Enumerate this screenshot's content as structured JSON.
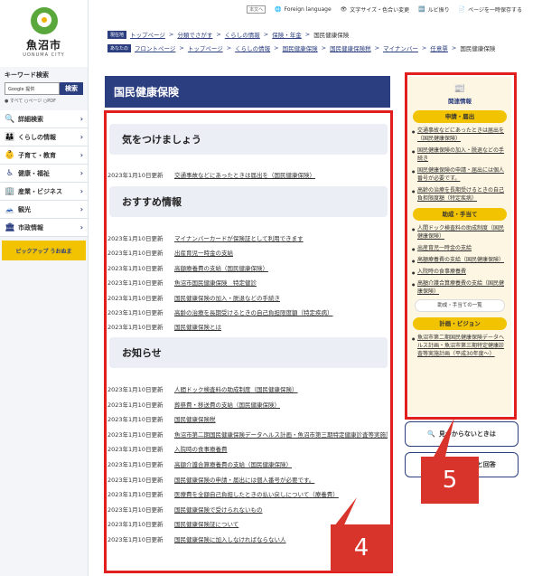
{
  "logo": {
    "name": "魚沼市",
    "sub": "UONUMA CITY"
  },
  "search": {
    "title": "キーワード検索",
    "engine": "Google 提供",
    "button": "検索",
    "options": "● すべて ○ページ ○PDF"
  },
  "menu": [
    {
      "icon": "🔍",
      "label": "詳細検索"
    },
    {
      "icon": "👪",
      "label": "くらしの情報"
    },
    {
      "icon": "👶",
      "label": "子育て・教育"
    },
    {
      "icon": "♿",
      "label": "健康・福祉"
    },
    {
      "icon": "🏢",
      "label": "産業・ビジネス"
    },
    {
      "icon": "🗻",
      "label": "観光"
    },
    {
      "icon": "🏛",
      "label": "市政情報"
    }
  ],
  "pickup": "ピックアップ うおぬま",
  "topbar": {
    "tag": "本文へ",
    "lang": "Foreign language",
    "size": "文字サイズ・色合い変更",
    "ruby": "ルビ振り",
    "save": "ページを一時保存する"
  },
  "crumb1": {
    "label": "現在地",
    "items": [
      "トップページ",
      "分類でさがす",
      "くらしの情報",
      "保険・年金"
    ],
    "current": "国民健康保険"
  },
  "crumb2": {
    "label": "あなたの",
    "items": [
      "フロントページ",
      "トップページ",
      "くらしの情報",
      "国民健康保険",
      "国民健康保険税",
      "マイナンバー",
      "任意票"
    ],
    "current": "国民健康保険"
  },
  "page_title": "国民健康保険",
  "sections": [
    {
      "heading": "気をつけましょう",
      "items": [
        {
          "date": "2023年1月10日更新",
          "text": "交通事故などにあったときは届出を（国民健康保険）"
        }
      ]
    },
    {
      "heading": "おすすめ情報",
      "items": [
        {
          "date": "2023年1月10日更新",
          "text": "マイナンバーカードが保険証として利用できます"
        },
        {
          "date": "2023年1月10日更新",
          "text": "出産育児一時金の支給"
        },
        {
          "date": "2023年1月10日更新",
          "text": "高額療養費の支給（国民健康保険）"
        },
        {
          "date": "2023年1月10日更新",
          "text": "魚沼市国民健康保険　特定健診"
        },
        {
          "date": "2023年1月10日更新",
          "text": "国民健康保険の加入・脱退などの手続き"
        },
        {
          "date": "2023年1月10日更新",
          "text": "高齢の治療を長期受けるときの自己負担限度額（特定疾病）"
        },
        {
          "date": "2023年1月10日更新",
          "text": "国民健康保険とは"
        }
      ]
    },
    {
      "heading": "お知らせ",
      "items": [
        {
          "date": "2023年1月10日更新",
          "text": "人間ドック検査料の助成制度（国民健康保険）"
        },
        {
          "date": "2023年1月10日更新",
          "text": "葬祭費・移送費の支給（国民健康保険）"
        },
        {
          "date": "2023年1月10日更新",
          "text": "国民健康保険税"
        },
        {
          "date": "2023年1月10日更新",
          "text": "魚沼市第二期国民健康保険データヘルス計画・魚沼市第三期特定健康診査等実施計画（平成30年度～）"
        },
        {
          "date": "2023年1月10日更新",
          "text": "入院時の食事療養費"
        },
        {
          "date": "2023年1月10日更新",
          "text": "高額介護合算療養費の支給（国民健康保険）"
        },
        {
          "date": "2023年1月10日更新",
          "text": "国民健康保険の申請・届出には個人番号が必要です。"
        },
        {
          "date": "2023年1月10日更新",
          "text": "医療費を全額自己負担したときの払い戻しについて（療養費）"
        },
        {
          "date": "2023年1月10日更新",
          "text": "国民健康保険で受けられないもの"
        },
        {
          "date": "2023年1月10日更新",
          "text": "国民健康保険証について"
        },
        {
          "date": "2023年1月10日更新",
          "text": "国民健康保険に加入しなければならない人"
        }
      ]
    }
  ],
  "related": {
    "title": "関連情報",
    "cats": [
      {
        "name": "申請・届出",
        "items": [
          "交通事故などにあったときは届出を（国民健康保険）",
          "国民健康保険の加入・脱退などの手続き",
          "国民健康保険の申請・届出には個人番号が必要です。",
          "高齢の治療を長期受けるときの自己負担限度額（特定疾病）"
        ]
      },
      {
        "name": "助成・手当て",
        "items": [
          "人間ドック検査料の助成制度（国民健康保険）",
          "出産育児一時金の支給",
          "高額療養費の支給（国民健康保険）",
          "入院時の食事療養費",
          "高額介護合算療養費の支給（国民健康保険）"
        ],
        "all": "助成・手当ての一覧"
      },
      {
        "name": "計画・ビジョン",
        "items": [
          "魚沼市第二期国民健康保険データヘルス計画・魚沼市第三期特定健康診査等実施計画（平成30年度～）"
        ]
      }
    ]
  },
  "buttons": {
    "notfound": "見つからないときは",
    "faq": "よくある質問と回答"
  },
  "callouts": [
    "4",
    "5"
  ]
}
